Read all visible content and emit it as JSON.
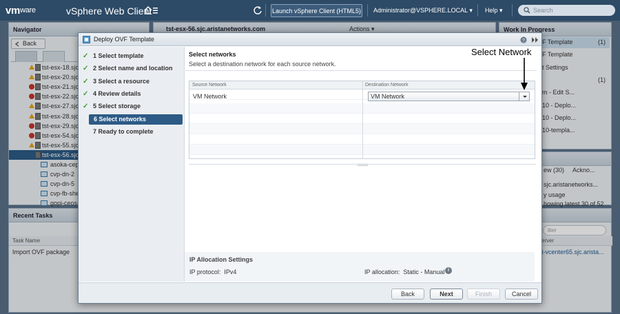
{
  "topbar": {
    "brand": "vm",
    "brand_suffix": "ware",
    "app_title": "vSphere Web Client",
    "launch_button": "Launch vSphere Client (HTML5)",
    "user_menu": "Administrator@VSPHERE.LOCAL",
    "help_menu": "Help",
    "search_placeholder": "Search"
  },
  "navigator": {
    "title": "Navigator",
    "back_label": "Back",
    "items": [
      {
        "label": "tst-esx-18.sjc",
        "status": "warn"
      },
      {
        "label": "tst-esx-20.sjc",
        "status": "warn"
      },
      {
        "label": "tst-esx-21.sjc",
        "status": "err"
      },
      {
        "label": "tst-esx-22.sjc",
        "status": "err"
      },
      {
        "label": "tst-esx-27.sjc",
        "status": "warn"
      },
      {
        "label": "tst-esx-28.sjc",
        "status": "warn"
      },
      {
        "label": "tst-esx-29.sjc",
        "status": "err"
      },
      {
        "label": "tst-esx-54.sjc",
        "status": "err"
      },
      {
        "label": "tst-esx-55.sjc",
        "status": "warn"
      },
      {
        "label": "tst-esx-56.sjc",
        "status": "selected"
      },
      {
        "label": "asoka-cep",
        "status": "vm"
      },
      {
        "label": "cvp-dn-2",
        "status": "vm"
      },
      {
        "label": "cvp-dn-5",
        "status": "vm"
      },
      {
        "label": "cvp-fb-she",
        "status": "vm"
      },
      {
        "label": "gopi-ceos-",
        "status": "vm"
      }
    ]
  },
  "center": {
    "host_title": "tst-esx-56.sjc.aristanetworks.com",
    "actions_label": "Actions"
  },
  "work_in_progress": {
    "title": "Work In Progress",
    "items": [
      {
        "label": "F Template",
        "count": "(1)"
      },
      {
        "label": "F Template",
        "count": ""
      },
      {
        "label": "t Settings",
        "count": ""
      },
      {
        "label": "",
        "count": "(1)"
      },
      {
        "label": "m - Edit S...",
        "count": ""
      },
      {
        "label": "10 - Deplo...",
        "count": ""
      },
      {
        "label": "10 - Deplo...",
        "count": ""
      },
      {
        "label": "10-templa...",
        "count": ""
      }
    ]
  },
  "alarms": {
    "tab_label": "ew (30)",
    "tab2_label": "Ackno...",
    "line1": "sjc.aristanetworks...",
    "line2": "y usage",
    "line3": "howing latest 30 of 52"
  },
  "recent_tasks": {
    "title": "Recent Tasks",
    "col_task_name": "Task Name",
    "col_server": "erver",
    "filter_placeholder": "ilter",
    "task_name": "Import OVF package",
    "server": "t-vcenter65.sjc.arista..."
  },
  "dialog": {
    "title": "Deploy OVF Template",
    "steps": [
      {
        "label": "1  Select template",
        "done": true,
        "current": false
      },
      {
        "label": "2  Select name and location",
        "done": true,
        "current": false
      },
      {
        "label": "3  Select a resource",
        "done": true,
        "current": false
      },
      {
        "label": "4  Review details",
        "done": true,
        "current": false
      },
      {
        "label": "5  Select storage",
        "done": true,
        "current": false
      },
      {
        "label": "6  Select networks",
        "done": false,
        "current": true
      },
      {
        "label": "7  Ready to complete",
        "done": false,
        "current": false
      }
    ],
    "section_title": "Select networks",
    "section_description": "Select a destination network for each source network.",
    "table": {
      "col_source": "Source Network",
      "col_destination": "Destination Network",
      "source_value": "VM Network",
      "destination_value": "VM Network"
    },
    "ip_allocation": {
      "title": "IP Allocation Settings",
      "protocol_label": "IP protocol:",
      "protocol_value": "IPv4",
      "allocation_label": "IP allocation:",
      "allocation_value": "Static - Manual"
    },
    "buttons": {
      "back": "Back",
      "next": "Next",
      "finish": "Finish",
      "cancel": "Cancel"
    }
  },
  "annotation": {
    "label": "Select Network"
  }
}
